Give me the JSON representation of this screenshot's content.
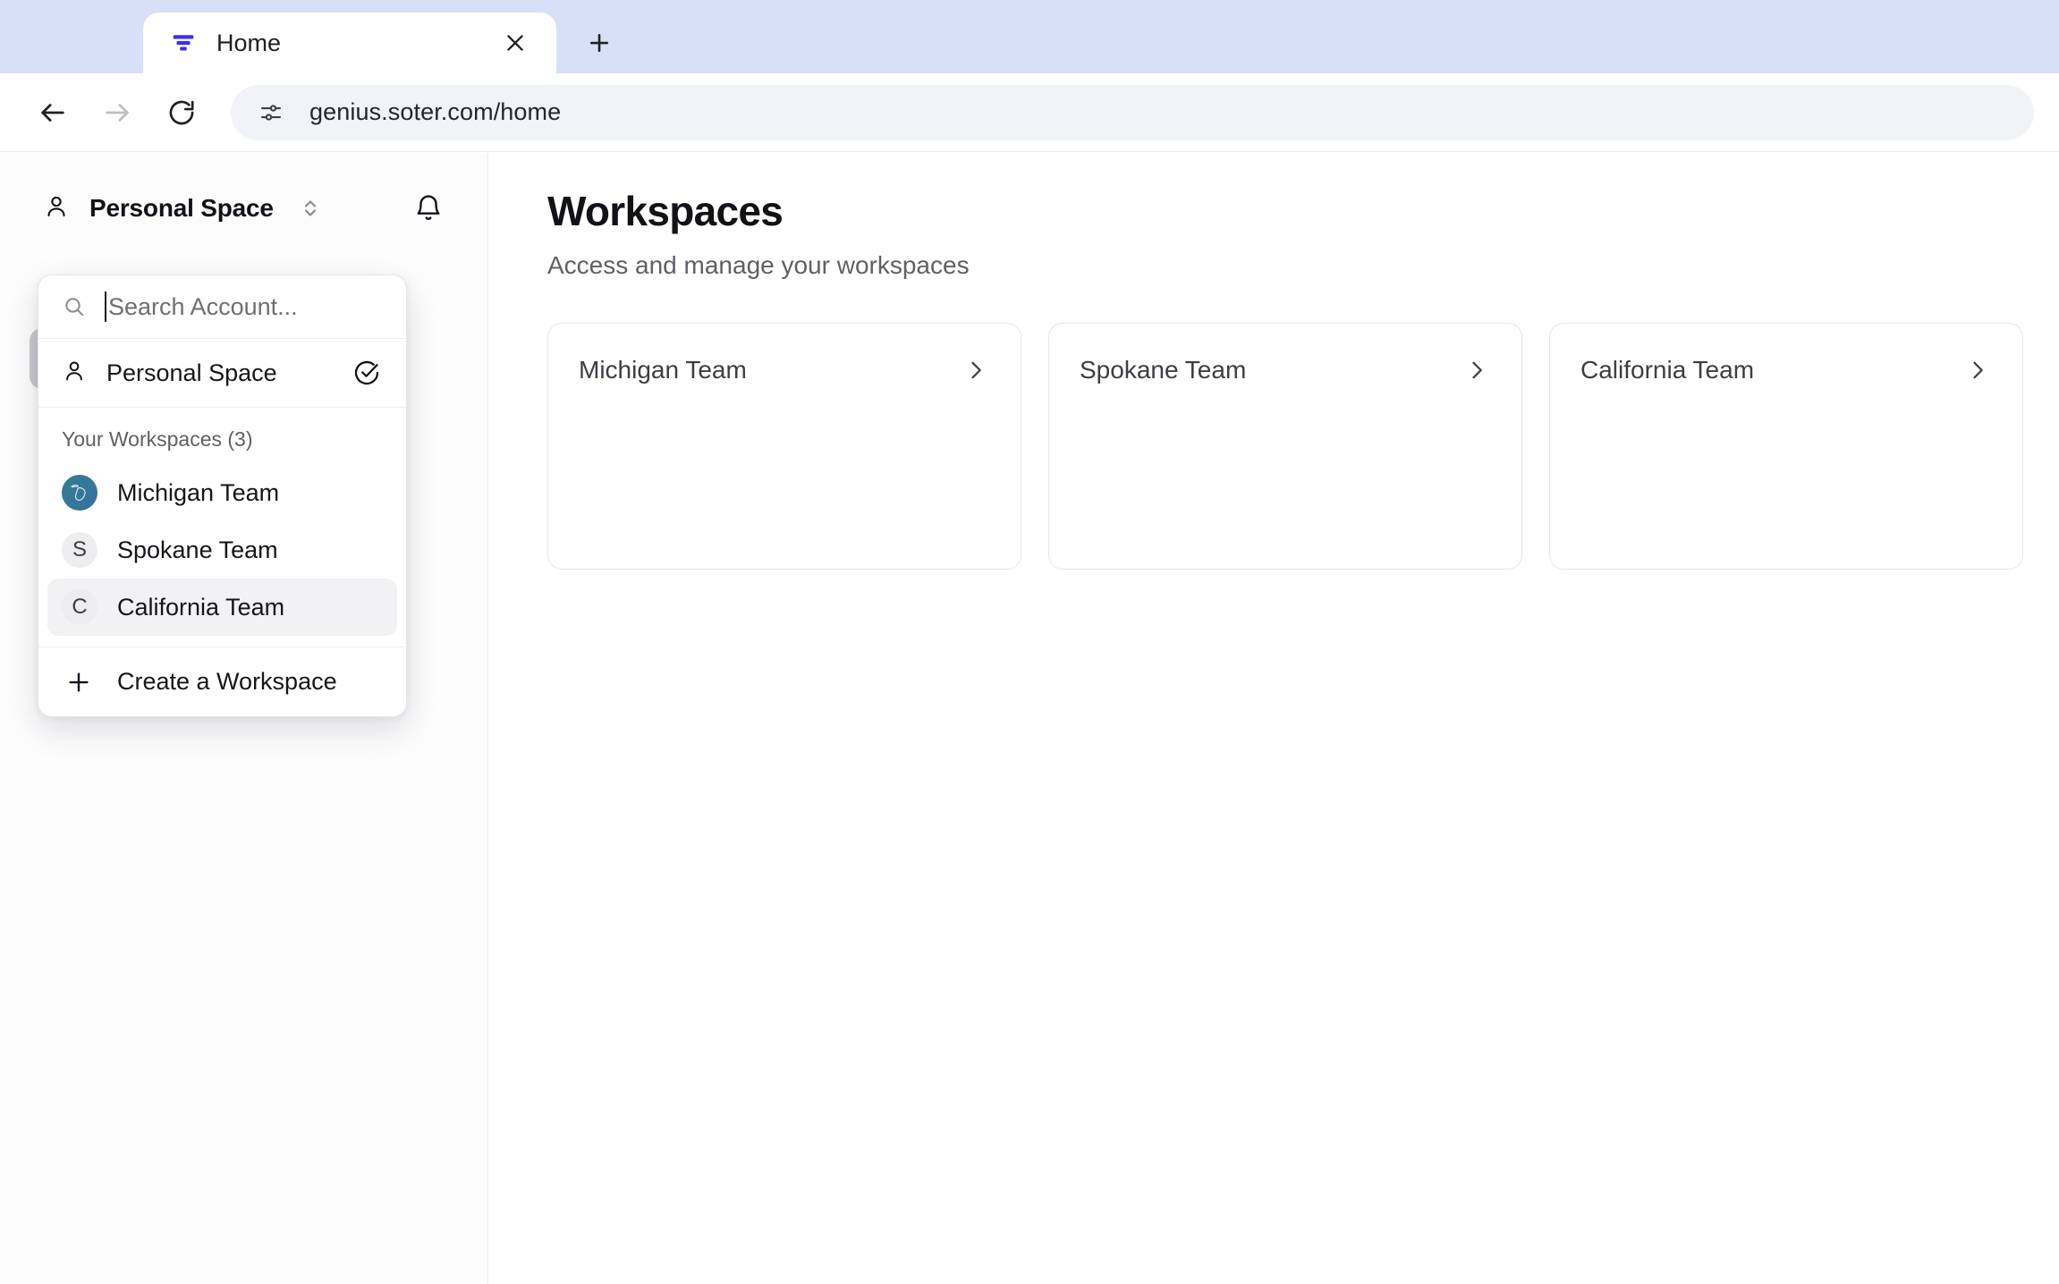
{
  "browser": {
    "tab": {
      "title": "Home",
      "favicon_icon": "filter-funnel-icon",
      "close_icon": "close-icon"
    },
    "new_tab_icon": "plus-icon",
    "back_icon": "arrow-left-icon",
    "forward_icon": "arrow-right-icon",
    "reload_icon": "reload-icon",
    "site_info_icon": "site-settings-icon",
    "url": "genius.soter.com/home"
  },
  "sidebar": {
    "account_name": "Personal Space",
    "account_icon": "user-icon",
    "switcher_icon": "chevron-up-down-icon",
    "notifications_icon": "bell-icon"
  },
  "dropdown": {
    "search": {
      "placeholder": "Search Account...",
      "value": "",
      "icon": "search-icon"
    },
    "personal": {
      "label": "Personal Space",
      "icon": "user-icon",
      "check_icon": "check-circle-icon",
      "selected": true
    },
    "section_label": "Your Workspaces (3)",
    "workspaces": [
      {
        "label": "Michigan Team",
        "avatar_text": "",
        "avatar_type": "michigan-map-icon",
        "selected": false
      },
      {
        "label": "Spokane Team",
        "avatar_text": "S",
        "avatar_type": "initial",
        "selected": false
      },
      {
        "label": "California Team",
        "avatar_text": "C",
        "avatar_type": "initial",
        "selected": true
      }
    ],
    "create": {
      "label": "Create a Workspace",
      "icon": "plus-icon"
    }
  },
  "main": {
    "title": "Workspaces",
    "subtitle": "Access and manage your workspaces",
    "cards": [
      {
        "title": "Michigan Team",
        "chevron_icon": "chevron-right-icon"
      },
      {
        "title": "Spokane Team",
        "chevron_icon": "chevron-right-icon"
      },
      {
        "title": "California Team",
        "chevron_icon": "chevron-right-icon"
      }
    ]
  },
  "colors": {
    "tabstrip": "#d7e0f7",
    "favicon_blue": "#3a2ff0",
    "michigan_avatar_start": "#2f7f93",
    "michigan_avatar_end": "#3a6f9e",
    "selected_row": "#f2f2f4",
    "skeleton": "#c8c9cb"
  }
}
